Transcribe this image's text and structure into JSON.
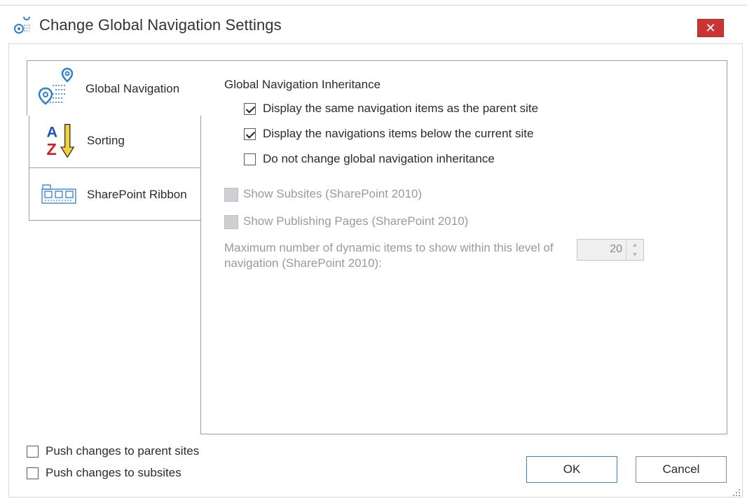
{
  "window": {
    "title": "Change Global Navigation Settings",
    "close_label": "✕",
    "icon": "navigation-pin-icon"
  },
  "tabs": [
    {
      "label": "Global Navigation",
      "icon": "global-navigation-icon",
      "selected": true
    },
    {
      "label": "Sorting",
      "icon": "az-sort-icon",
      "selected": false
    },
    {
      "label": "SharePoint Ribbon",
      "icon": "ribbon-icon",
      "selected": false
    }
  ],
  "panel": {
    "section_title": "Global Navigation Inheritance",
    "options": [
      {
        "label": "Display the same navigation items as the parent site",
        "checked": true,
        "enabled": true
      },
      {
        "label": "Display the navigations items below the current site",
        "checked": true,
        "enabled": true
      },
      {
        "label": "Do not change global navigation inheritance",
        "checked": false,
        "enabled": true
      },
      {
        "label": "Show Subsites (SharePoint 2010)",
        "checked": false,
        "enabled": false
      },
      {
        "label": "Show Publishing Pages (SharePoint 2010)",
        "checked": false,
        "enabled": false
      }
    ],
    "max_items_label": "Maximum number of dynamic items to show within this level of navigation (SharePoint 2010):",
    "max_items_value": "20"
  },
  "footer": {
    "push_parent_label": "Push changes to parent sites",
    "push_parent_checked": false,
    "push_subsites_label": "Push changes to subsites",
    "push_subsites_checked": false,
    "ok_label": "OK",
    "cancel_label": "Cancel"
  },
  "colors": {
    "close_bg": "#cc3333",
    "accent": "#3c7fd0",
    "disabled_text": "#9a9a9a"
  }
}
